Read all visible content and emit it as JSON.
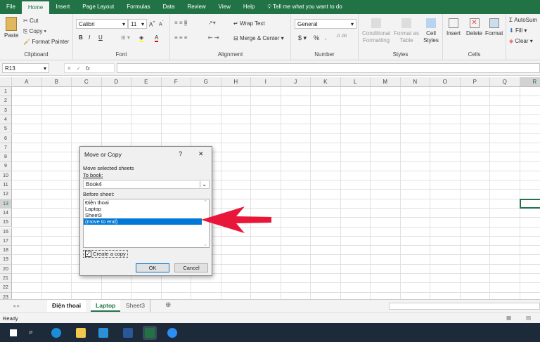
{
  "ribbon_tabs": [
    "File",
    "Home",
    "Insert",
    "Page Layout",
    "Formulas",
    "Data",
    "Review",
    "View",
    "Help"
  ],
  "tell_me": "Tell me what you want to do",
  "clipboard": {
    "paste": "Paste",
    "cut": "Cut",
    "copy": "Copy",
    "format_painter": "Format Painter",
    "label": "Clipboard"
  },
  "font": {
    "name": "Calibri",
    "size": "11",
    "bold": "B",
    "italic": "I",
    "underline": "U",
    "label": "Font"
  },
  "alignment": {
    "wrap": "Wrap Text",
    "merge": "Merge & Center",
    "label": "Alignment"
  },
  "number": {
    "format": "General",
    "currency": "$",
    "percent": "%",
    "comma": ",",
    "label": "Number"
  },
  "styles": {
    "conditional": "Conditional Formatting",
    "format_table": "Format as Table",
    "cell_styles": "Cell Styles",
    "label": "Styles"
  },
  "cells": {
    "insert": "Insert",
    "delete": "Delete",
    "format": "Format",
    "label": "Cells"
  },
  "editing": {
    "autosum": "AutoSum",
    "fill": "Fill",
    "clear": "Clear"
  },
  "name_box": "R13",
  "fx": "fx",
  "columns": [
    "A",
    "B",
    "C",
    "D",
    "E",
    "F",
    "G",
    "H",
    "I",
    "J",
    "K",
    "L",
    "M",
    "N",
    "O",
    "P",
    "Q",
    "R"
  ],
  "rows": [
    "1",
    "2",
    "3",
    "4",
    "5",
    "6",
    "7",
    "8",
    "9",
    "10",
    "11",
    "12",
    "13",
    "14",
    "15",
    "16",
    "17",
    "18",
    "19",
    "20",
    "21",
    "22",
    "23"
  ],
  "selected_cell": {
    "column": "R",
    "row": "13"
  },
  "sheets": [
    {
      "name": "Điện thoai",
      "bold": true
    },
    {
      "name": "Laptop",
      "active": true
    },
    {
      "name": "Sheet3"
    }
  ],
  "status": "Ready",
  "dialog": {
    "title": "Move or Copy",
    "help": "?",
    "close": "✕",
    "move_label": "Move selected sheets",
    "to_book_label": "To book:",
    "to_book_value": "Book4",
    "before_sheet_label": "Before sheet:",
    "items": [
      "Điện thoai",
      "Laptop",
      "Sheet3",
      "(move to end)"
    ],
    "selected_index": 3,
    "create_copy": "Create a copy",
    "create_copy_checked": true,
    "ok": "OK",
    "cancel": "Cancel"
  },
  "colors": {
    "excel_green": "#217346",
    "selection_blue": "#0078d7",
    "arrow_red": "#e8173a"
  },
  "taskbar_icons": [
    "windows-start-icon",
    "search-icon",
    "edge-icon",
    "file-explorer-icon",
    "store-icon",
    "word-icon",
    "excel-icon",
    "zalo-icon"
  ]
}
